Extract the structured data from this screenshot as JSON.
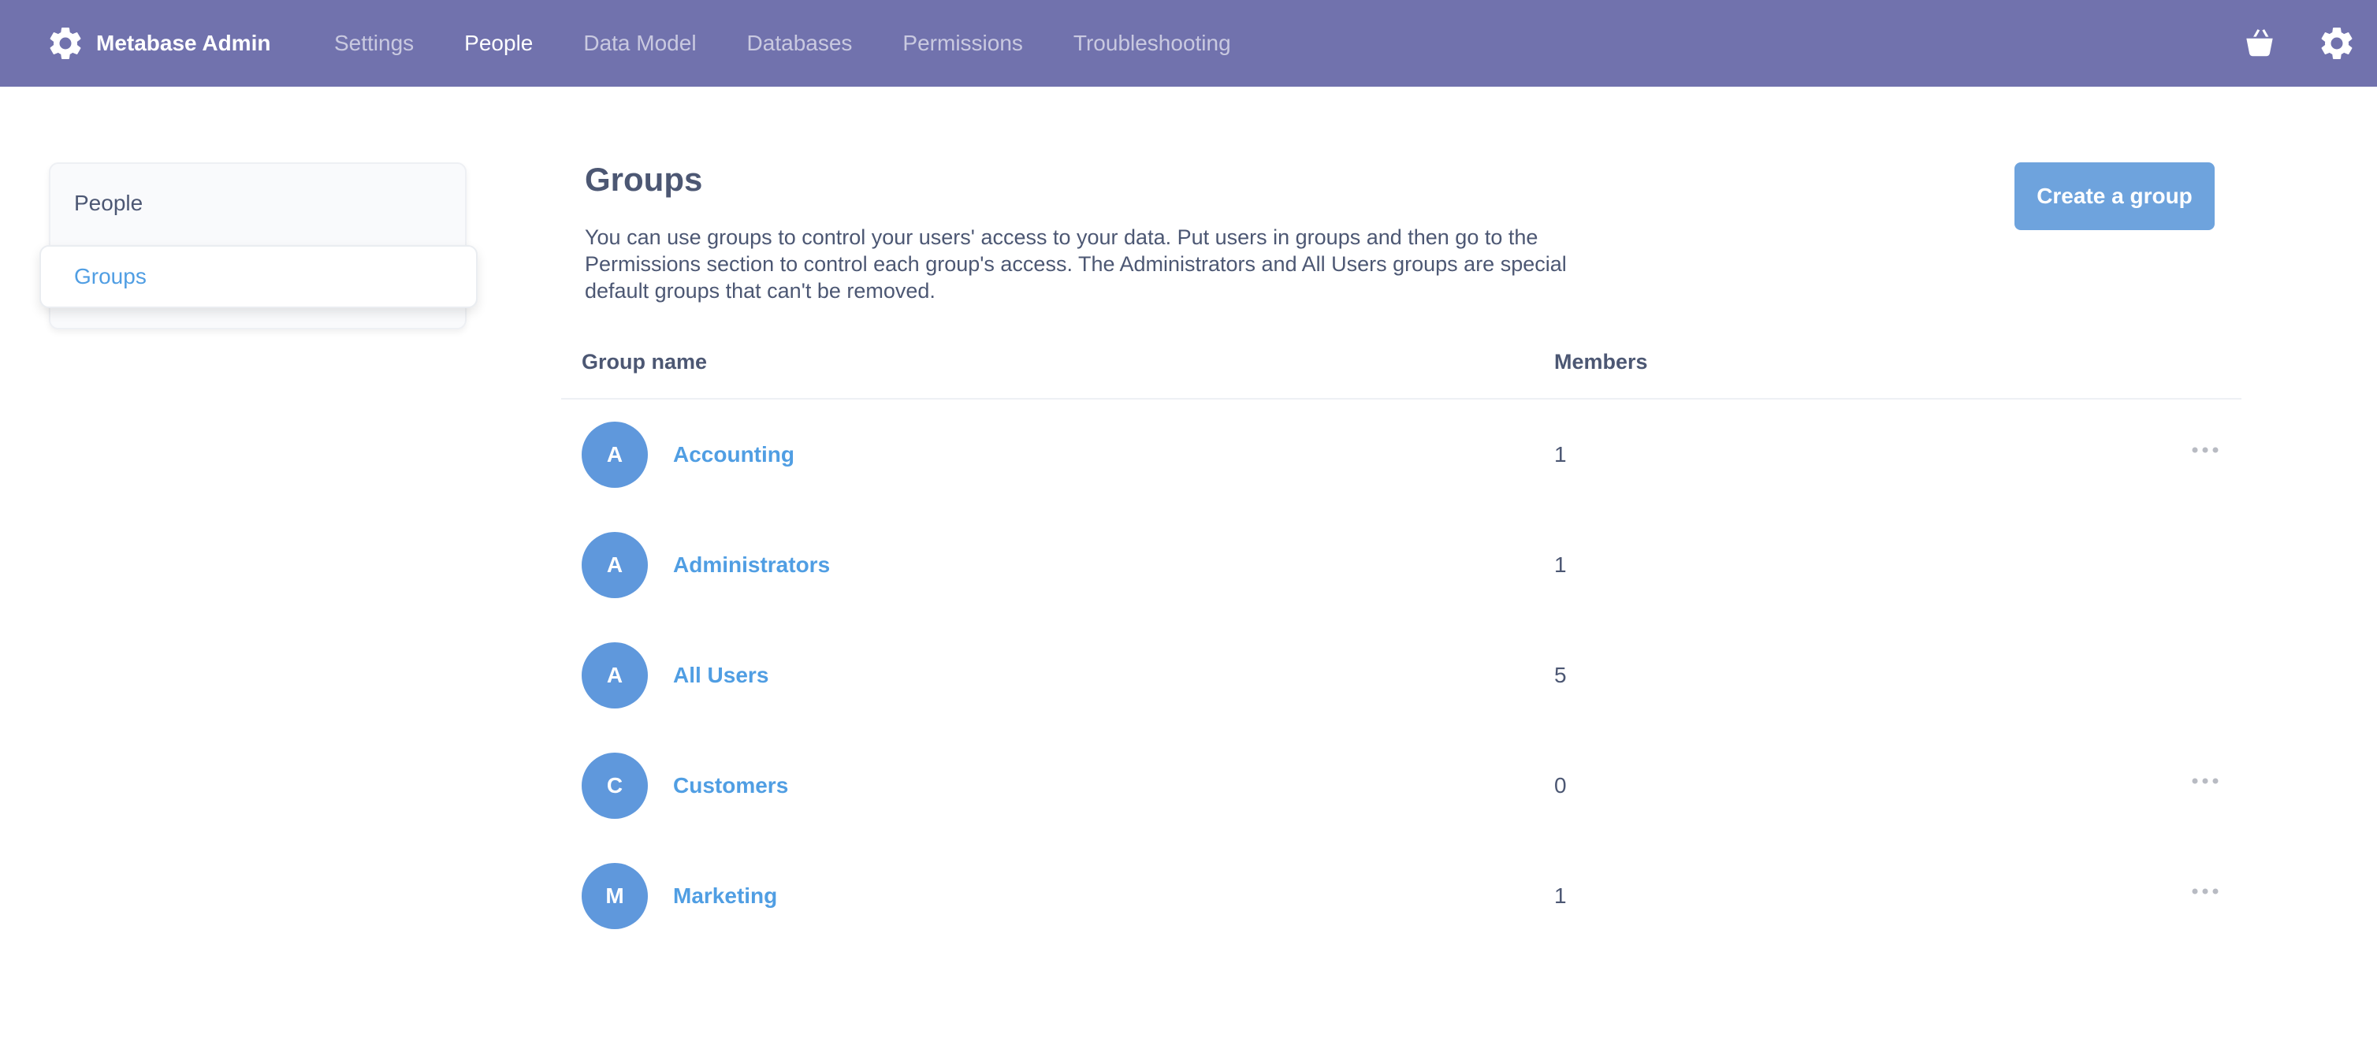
{
  "app": {
    "brand": "Metabase Admin",
    "accent_color": "#509ee3",
    "topbar_color": "#7172ad"
  },
  "nav": {
    "items": [
      {
        "label": "Settings",
        "active": false
      },
      {
        "label": "People",
        "active": true
      },
      {
        "label": "Data Model",
        "active": false
      },
      {
        "label": "Databases",
        "active": false
      },
      {
        "label": "Permissions",
        "active": false
      },
      {
        "label": "Troubleshooting",
        "active": false
      }
    ],
    "right_icons": [
      "basket-icon",
      "gear-icon"
    ]
  },
  "sidebar": {
    "items": [
      {
        "label": "People",
        "selected": false
      },
      {
        "label": "Groups",
        "selected": true
      }
    ]
  },
  "main": {
    "title": "Groups",
    "description": "You can use groups to control your users' access to your data. Put users in groups and then go to the Permissions section to control each group's access. The Administrators and All Users groups are special default groups that can't be removed.",
    "create_button": "Create a group",
    "table": {
      "headers": {
        "name": "Group name",
        "members": "Members"
      },
      "rows": [
        {
          "initial": "A",
          "name": "Accounting",
          "members": "1",
          "has_menu": true
        },
        {
          "initial": "A",
          "name": "Administrators",
          "members": "1",
          "has_menu": false
        },
        {
          "initial": "A",
          "name": "All Users",
          "members": "5",
          "has_menu": false
        },
        {
          "initial": "C",
          "name": "Customers",
          "members": "0",
          "has_menu": true
        },
        {
          "initial": "M",
          "name": "Marketing",
          "members": "1",
          "has_menu": true
        }
      ]
    }
  }
}
